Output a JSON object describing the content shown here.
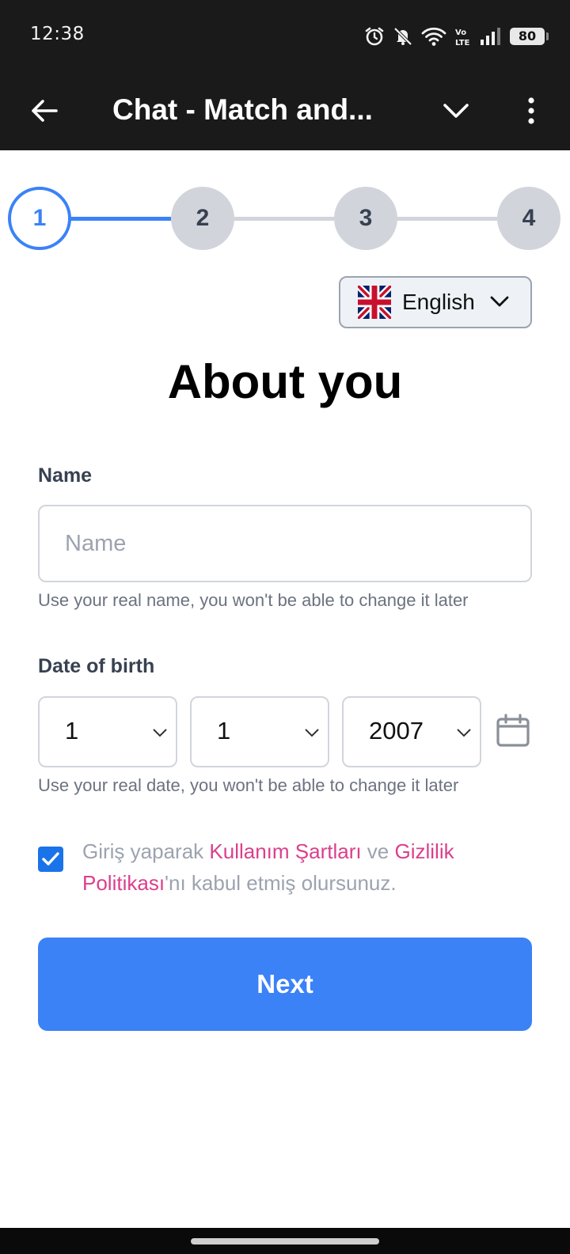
{
  "status_bar": {
    "time": "12:38",
    "battery": "80",
    "icons": [
      "alarm-icon",
      "bell-muted-icon",
      "wifi-icon",
      "volte-icon",
      "signal-icon",
      "battery-icon"
    ]
  },
  "app_bar": {
    "title": "Chat - Match and..."
  },
  "stepper": {
    "steps": [
      "1",
      "2",
      "3",
      "4"
    ],
    "current_step": 1
  },
  "language": {
    "label": "English",
    "flag": "uk-flag-icon"
  },
  "page": {
    "title": "About you"
  },
  "name": {
    "label": "Name",
    "placeholder": "Name",
    "value": "",
    "hint": "Use your real name, you won't be able to change it later"
  },
  "dob": {
    "label": "Date of birth",
    "day": "1",
    "month": "1",
    "year": "2007",
    "hint": "Use your real date, you won't be able to change it later"
  },
  "consent": {
    "checked": true,
    "prefix": "Giriş yaparak ",
    "terms_link": "Kullanım Şartları",
    "middle": " ve ",
    "privacy_link": "Gizlilik Politikası",
    "suffix": "'nı kabul etmiş olursunuz."
  },
  "actions": {
    "next_label": "Next"
  },
  "colors": {
    "accent": "#3b82f6",
    "link": "#db3f8c",
    "app_bar": "#1a1a1a",
    "step_inactive": "#d1d5db"
  }
}
